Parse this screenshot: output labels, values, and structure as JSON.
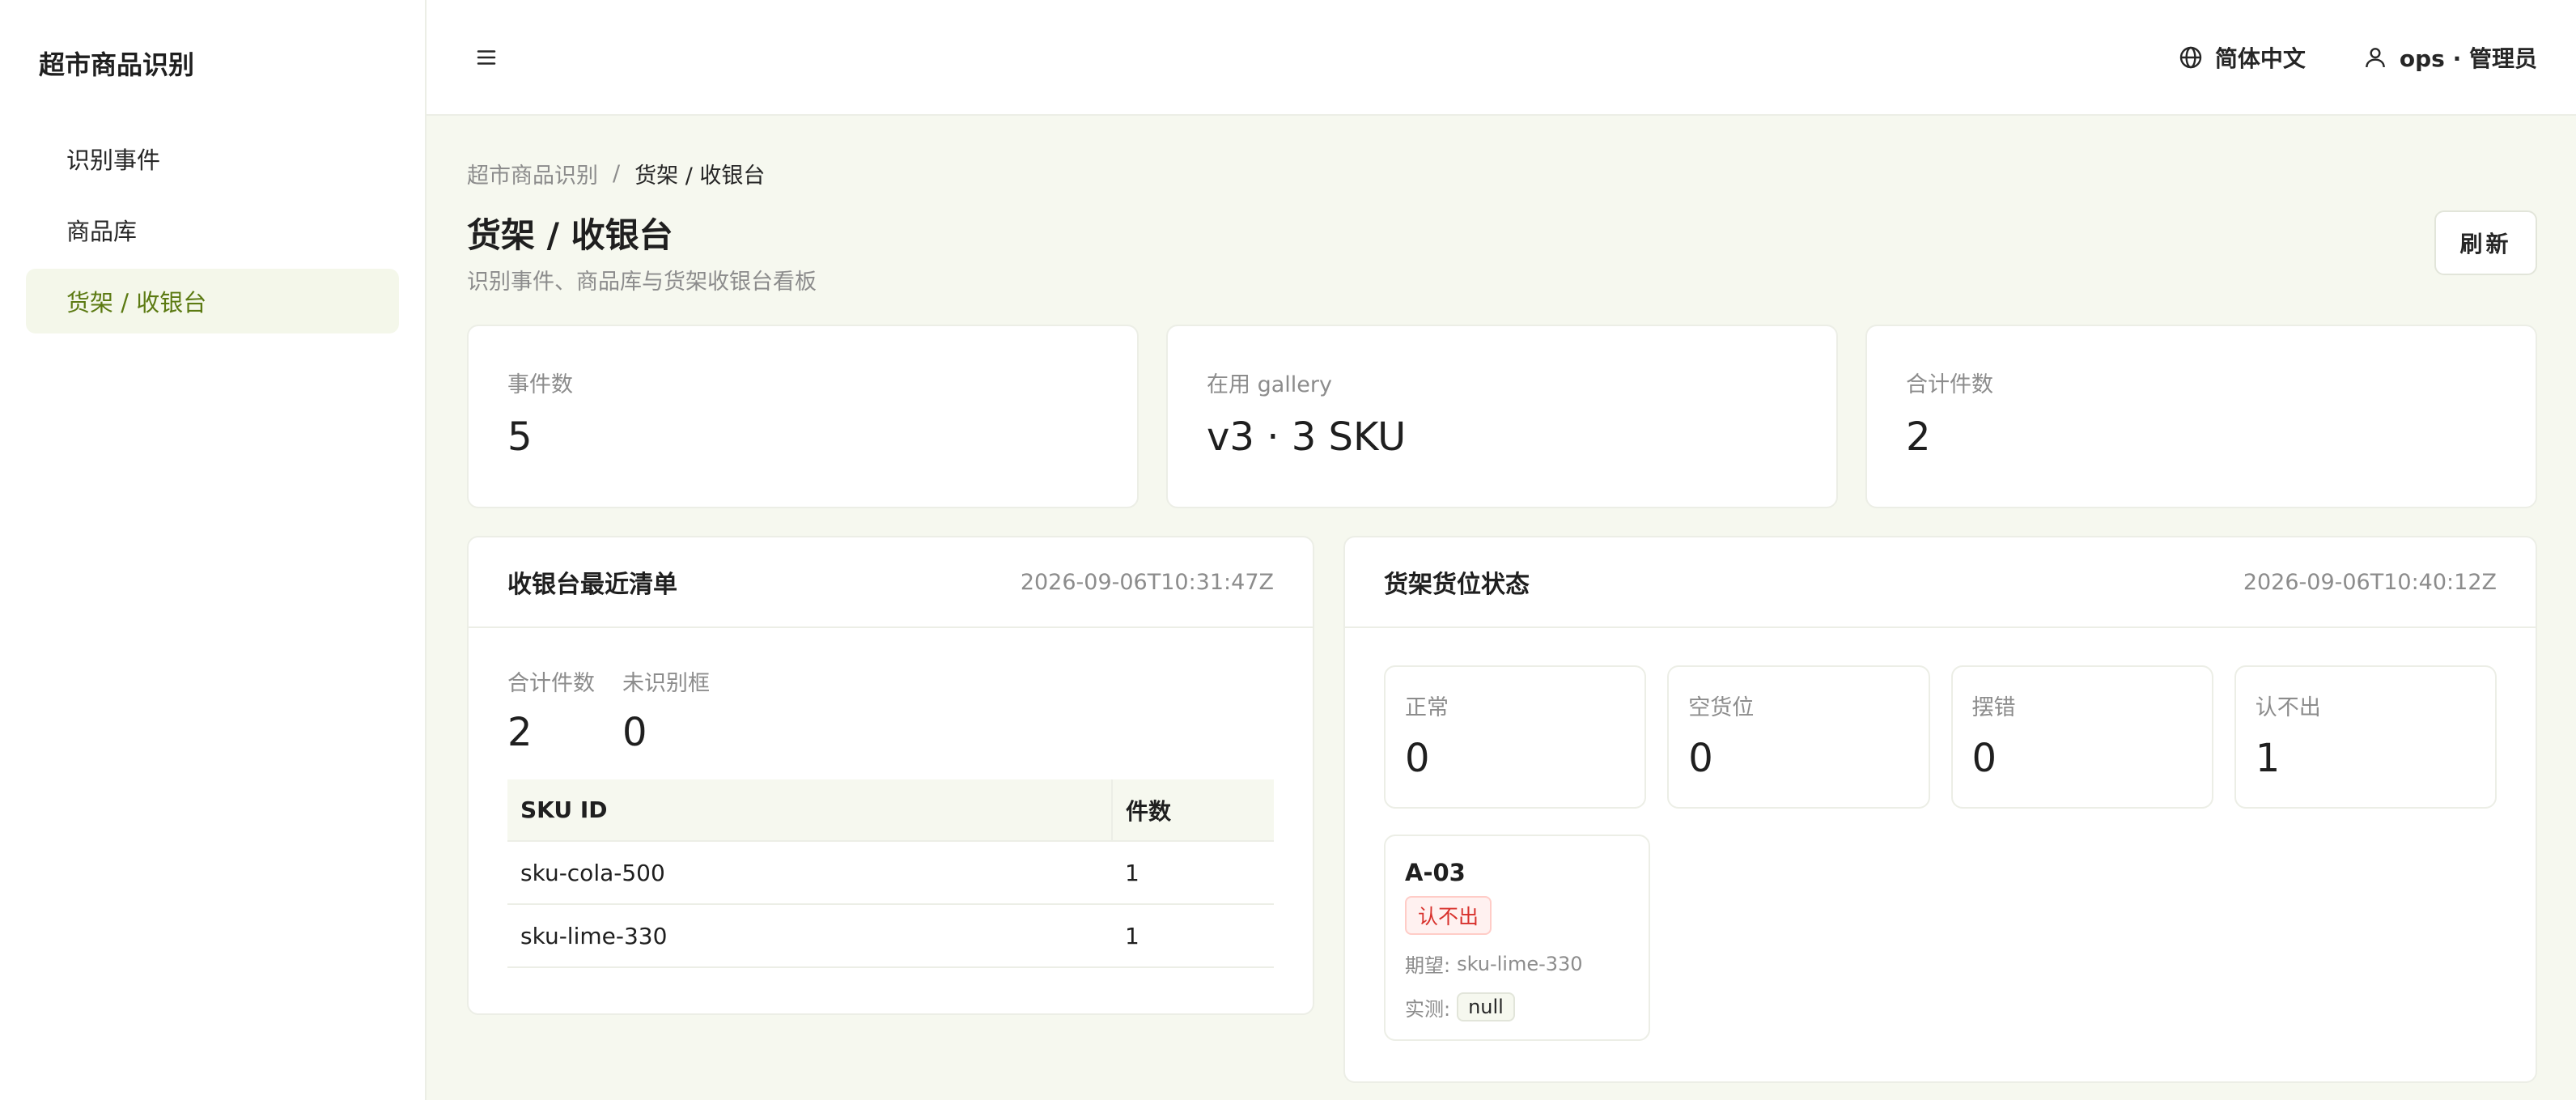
{
  "sidebar": {
    "brand": "超市商品识别",
    "items": [
      {
        "label": "识别事件"
      },
      {
        "label": "商品库"
      },
      {
        "label": "货架 / 收银台"
      }
    ]
  },
  "header": {
    "language": "简体中文",
    "user": "ops · 管理员"
  },
  "breadcrumb": {
    "root": "超市商品识别",
    "separator": "/",
    "current": "货架 / 收银台"
  },
  "page": {
    "title": "货架 / 收银台",
    "subtitle": "识别事件、商品库与货架收银台看板",
    "refresh_label": "刷新"
  },
  "stats": [
    {
      "label": "事件数",
      "value": "5"
    },
    {
      "label": "在用 gallery",
      "value": "v3 · 3 SKU"
    },
    {
      "label": "合计件数",
      "value": "2"
    }
  ],
  "checkout": {
    "title": "收银台最近清单",
    "timestamp": "2026-09-06T10:31:47Z",
    "summary": [
      {
        "label": "合计件数",
        "value": "2"
      },
      {
        "label": "未识别框",
        "value": "0"
      }
    ],
    "columns": [
      "SKU ID",
      "件数"
    ],
    "rows": [
      {
        "sku": "sku-cola-500",
        "count": "1"
      },
      {
        "sku": "sku-lime-330",
        "count": "1"
      }
    ]
  },
  "shelf": {
    "title": "货架货位状态",
    "timestamp": "2026-09-06T10:40:12Z",
    "summary": [
      {
        "label": "正常",
        "value": "0"
      },
      {
        "label": "空货位",
        "value": "0"
      },
      {
        "label": "摆错",
        "value": "0"
      },
      {
        "label": "认不出",
        "value": "1"
      }
    ],
    "slots": [
      {
        "code": "A-03",
        "status": "认不出",
        "expected_label": "期望: ",
        "expected": "sku-lime-330",
        "actual_label": "实测: ",
        "actual": "null"
      }
    ]
  },
  "colors": {
    "accent": "#5b7a12",
    "active_bg": "#f4f7ea",
    "page_bg": "#f6f8ef",
    "error": "#d8312c"
  },
  "icons": {
    "menu": "menu-icon",
    "language": "globe-icon",
    "user": "user-icon"
  }
}
